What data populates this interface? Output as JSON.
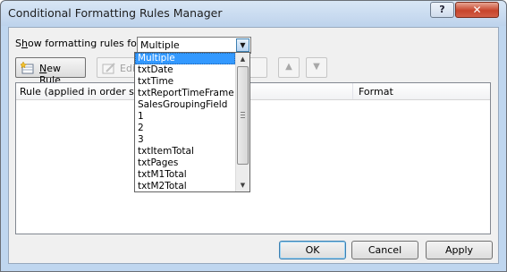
{
  "window": {
    "title": "Conditional Formatting Rules Manager",
    "help_label": "?",
    "close_label": "✕"
  },
  "filter": {
    "label_pre": "S",
    "label_accel": "h",
    "label_post": "ow formatting rules for:",
    "selected": "Multiple"
  },
  "toolbar": {
    "new_rule_accel": "N",
    "new_rule_rest": "ew Rule",
    "edit_visible": "Edi",
    "move_up_icon": "up-triangle",
    "move_down_icon": "down-triangle"
  },
  "rules_table": {
    "col_rule": "Rule (applied in order show",
    "col_format": "Format"
  },
  "dropdown": {
    "options": [
      "Multiple",
      "txtDate",
      "txtTime",
      "txtReportTimeFrame",
      "SalesGroupingField",
      "1",
      "2",
      "3",
      "txtItemTotal",
      "txtPages",
      "txtM1Total",
      "txtM2Total"
    ]
  },
  "buttons": {
    "ok": "OK",
    "cancel": "Cancel",
    "apply": "Apply"
  },
  "colors": {
    "selection": "#3399ff",
    "title_bar": "#bed3ec",
    "close_button": "#c7452c"
  }
}
